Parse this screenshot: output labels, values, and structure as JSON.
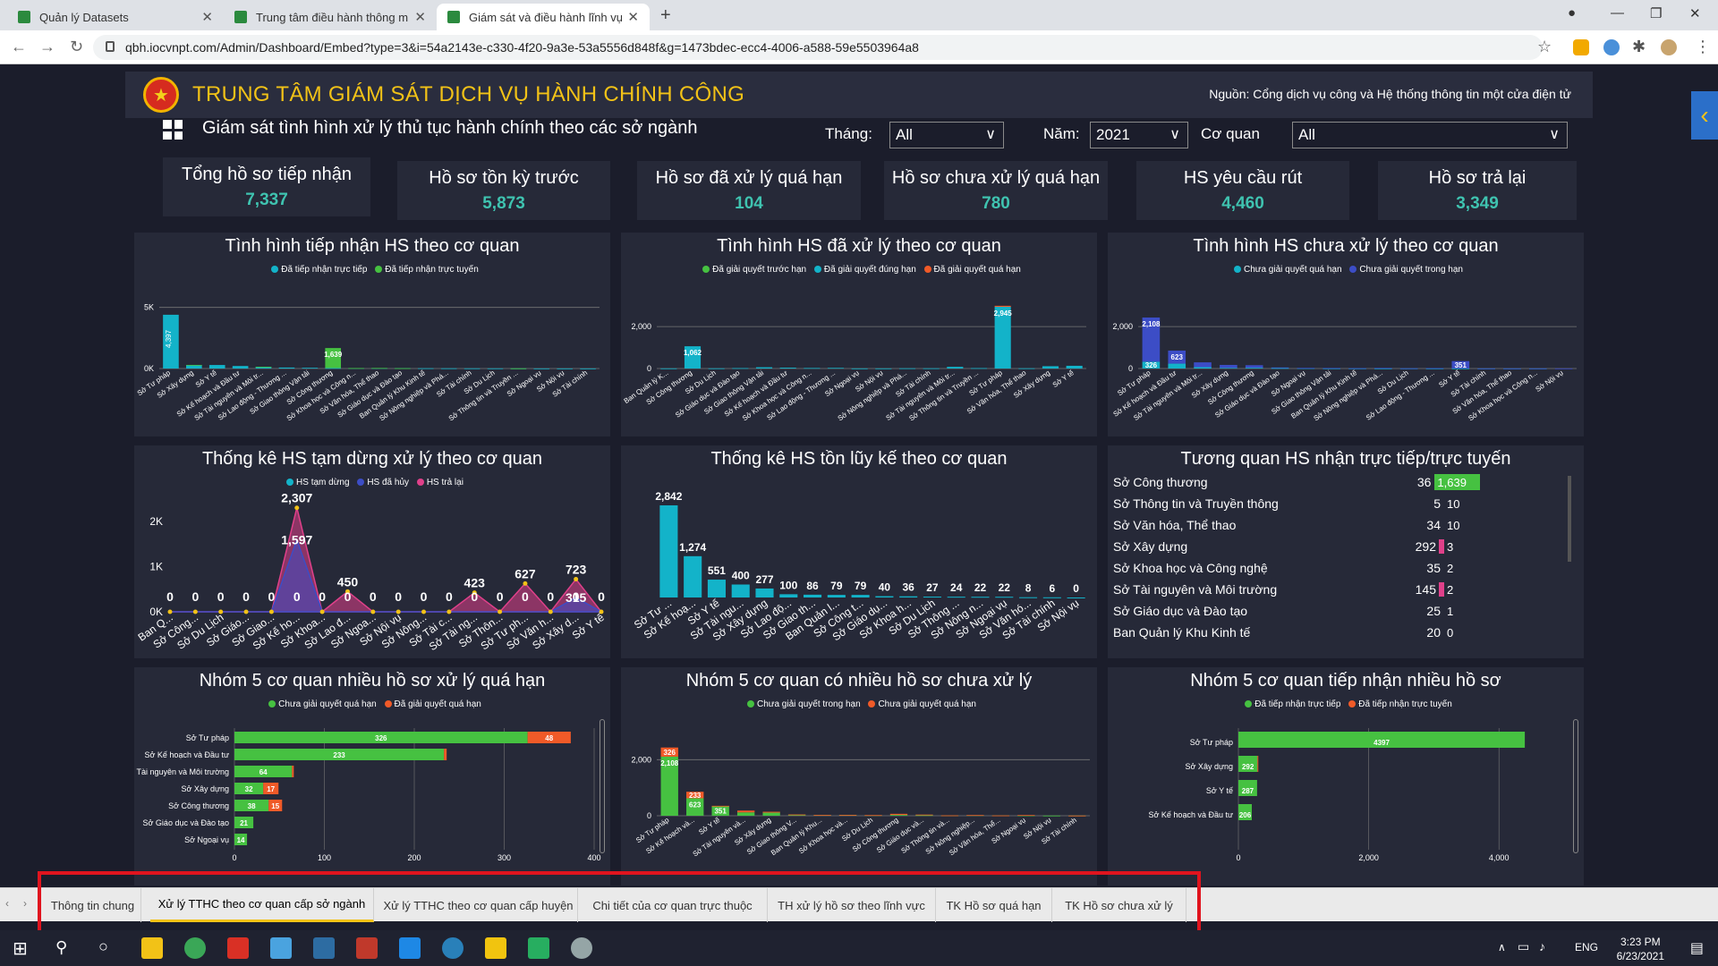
{
  "browser": {
    "tabs": [
      {
        "title": "Quản lý Datasets"
      },
      {
        "title": "Trung tâm điều hành thông minh"
      },
      {
        "title": "Giám sát và điều hành lĩnh vực D"
      }
    ],
    "url": "qbh.iocvnpt.com/Admin/Dashboard/Embed?type=3&i=54a2143e-c330-4f20-9a3e-53a5556d848f&g=1473bdec-ecc4-4006-a588-59e5503964a8"
  },
  "header": {
    "title": "TRUNG TÂM GIÁM SÁT DỊCH VỤ HÀNH CHÍNH CÔNG",
    "source": "Nguồn: Cổng dịch vụ công và Hệ thống thông tin một cửa điện tử"
  },
  "subtitle": "Giám sát tình hình xử lý thủ tục hành chính theo các sở ngành",
  "filters": {
    "month_label": "Tháng:",
    "month_value": "All",
    "year_label": "Năm:",
    "year_value": "2021",
    "agency_label": "Cơ quan",
    "agency_value": "All"
  },
  "kpis": [
    {
      "label": "Tổng hồ sơ tiếp nhận",
      "value": "7,337"
    },
    {
      "label": "Hồ sơ tồn kỳ trước",
      "value": "5,873"
    },
    {
      "label": "Hồ sơ đã xử lý quá hạn",
      "value": "104"
    },
    {
      "label": "Hồ sơ chưa xử lý quá hạn",
      "value": "780"
    },
    {
      "label": "HS yêu cầu rút",
      "value": "4,460"
    },
    {
      "label": "Hồ sơ trả lại",
      "value": "3,349"
    }
  ],
  "panels": {
    "p1": {
      "title": "Tình hình tiếp nhận HS theo cơ quan",
      "legend": [
        "Đã tiếp nhận trực tiếp",
        "Đã tiếp nhận trực tuyến"
      ]
    },
    "p2": {
      "title": "Tình hình HS đã xử lý theo cơ quan",
      "legend": [
        "Đã giải quyết trước hạn",
        "Đã giải quyết đúng hạn",
        "Đã giải quyết quá hạn"
      ]
    },
    "p3": {
      "title": "Tình hình HS chưa xử lý theo cơ quan",
      "legend": [
        "Chưa giải quyết quá hạn",
        "Chưa giải quyết trong hạn"
      ]
    },
    "p4": {
      "title": "Thống kê HS tạm dừng xử lý theo cơ quan",
      "legend": [
        "HS tạm dừng",
        "HS đã hủy",
        "HS trả lại"
      ]
    },
    "p5": {
      "title": "Thống kê HS tồn lũy kế theo cơ quan"
    },
    "p6": {
      "title": "Tương quan HS nhận trực tiếp/trực tuyến"
    },
    "p7": {
      "title": "Nhóm 5 cơ quan nhiều hồ sơ xử lý quá hạn",
      "legend": [
        "Chưa giải quyết quá hạn",
        "Đã giải quyết quá hạn"
      ]
    },
    "p8": {
      "title": "Nhóm 5 cơ quan có nhiều hồ sơ chưa xử lý",
      "legend": [
        "Chưa giải quyết trong hạn",
        "Chưa giải quyết quá hạn"
      ]
    },
    "p9": {
      "title": "Nhóm 5 cơ quan tiếp nhận nhiều hồ sơ",
      "legend": [
        "Đã tiếp nhận trực tiếp",
        "Đã tiếp nhận trực tuyến"
      ]
    }
  },
  "correlation": [
    {
      "name": "Sở Công thương",
      "direct": "36",
      "online": "1,639"
    },
    {
      "name": "Sở Thông tin và Truyền thông",
      "direct": "5",
      "online": "10"
    },
    {
      "name": "Sở Văn hóa, Thể thao",
      "direct": "34",
      "online": "10"
    },
    {
      "name": "Sở Xây dựng",
      "direct": "292",
      "online": "3"
    },
    {
      "name": "Sở Khoa học và Công nghệ",
      "direct": "35",
      "online": "2"
    },
    {
      "name": "Sở Tài nguyên và Môi trường",
      "direct": "145",
      "online": "2"
    },
    {
      "name": "Sở Giáo dục và Đào tạo",
      "direct": "25",
      "online": "1"
    },
    {
      "name": "Ban Quản lý Khu Kinh tế",
      "direct": "20",
      "online": "0"
    }
  ],
  "report_tabs": [
    {
      "label": "Thông tin chung"
    },
    {
      "label": "Xử lý TTHC theo cơ quan cấp sở ngành"
    },
    {
      "label": "Xử lý TTHC theo cơ quan cấp huyện"
    },
    {
      "label": "Chi tiết của cơ quan trực thuộc"
    },
    {
      "label": "TH xử lý hồ sơ theo lĩnh vực"
    },
    {
      "label": "TK Hồ sơ quá hạn"
    },
    {
      "label": "TK Hồ sơ chưa xử lý"
    }
  ],
  "taskbar": {
    "lang": "ENG",
    "time": "3:23 PM",
    "date": "6/23/2021"
  },
  "colors": {
    "teal": "#13b3c9",
    "green": "#46c141",
    "blue": "#3c4dc6",
    "orange": "#f05a28",
    "pink": "#e0408a",
    "yellow": "#f2c217"
  },
  "chart_data": [
    {
      "type": "bar",
      "title": "Tình hình tiếp nhận HS theo cơ quan",
      "categories": [
        "Sở Tư pháp",
        "Sở Xây dựng",
        "Sở Y tế",
        "Sở Kế hoạch và Đầu tư",
        "Sở Tài nguyên và Môi tr...",
        "Sở Lao động - Thương ...",
        "Sở Giao thông Vận tải",
        "Sở Công thương",
        "Sở Khoa học và Công n...",
        "Sở Văn hóa, Thể thao",
        "Sở Giáo dục và Đào tạo",
        "Ban Quản lý Khu Kinh tế",
        "Sở Nông nghiệp và Phá...",
        "Sở Tài chính",
        "Sở Du Lịch",
        "Sở Thông tin và Truyền ...",
        "Sở Ngoại vụ",
        "Sở Nội vụ",
        "Sở Tài chính"
      ],
      "series": [
        {
          "name": "Đã tiếp nhận trực tiếp",
          "values": [
            4397,
            292,
            287,
            206,
            145,
            80,
            60,
            36,
            35,
            34,
            25,
            20,
            15,
            12,
            10,
            5,
            4,
            3,
            2
          ],
          "labels": {
            "0": "4,397"
          }
        },
        {
          "name": "Đã tiếp nhận trực tuyến",
          "values": [
            0,
            3,
            0,
            0,
            2,
            0,
            0,
            1639,
            2,
            10,
            1,
            0,
            0,
            0,
            0,
            10,
            0,
            0,
            0
          ],
          "labels": {
            "7": "1,639"
          }
        }
      ],
      "ylim": [
        0,
        6000
      ],
      "yticks": [
        "0K",
        "5K"
      ],
      "stacked": true
    },
    {
      "type": "bar",
      "title": "Tình hình HS đã xử lý theo cơ quan",
      "categories": [
        "Ban Quản lý K...",
        "Sở Công thương",
        "Sở Du Lịch",
        "Sở Giáo dục và Đào tạo",
        "Sở Giao thông Vận tải",
        "Sở Kế hoạch và Đầu tư",
        "Sở Khoa học và Công n...",
        "Sở Lao động - Thương ...",
        "Sở Ngoại vụ",
        "Sở Nội vụ",
        "Sở Nông nghiệp và Phá...",
        "Sở Tài chính",
        "Sở Tài nguyên và Môi tr...",
        "Sở Thông tin và Truyền ...",
        "Sở Tư pháp",
        "Sở Văn hóa, Thể thao",
        "Sở Xây dựng",
        "Sở Y tế"
      ],
      "series": [
        {
          "name": "Đã giải quyết trước hạn",
          "values": [
            0,
            0,
            0,
            0,
            0,
            0,
            0,
            0,
            0,
            0,
            0,
            0,
            0,
            0,
            0,
            0,
            0,
            0
          ]
        },
        {
          "name": "Đã giải quyết đúng hạn",
          "values": [
            5,
            1062,
            8,
            20,
            60,
            40,
            25,
            30,
            3,
            4,
            10,
            10,
            80,
            20,
            2945,
            10,
            110,
            130
          ],
          "labels": {
            "1": "1,062",
            "14": "2,945"
          }
        },
        {
          "name": "Đã giải quyết quá hạn",
          "values": [
            0,
            0,
            0,
            0,
            0,
            0,
            0,
            0,
            0,
            0,
            0,
            0,
            0,
            0,
            48,
            0,
            0,
            0
          ]
        }
      ],
      "ylim": [
        0,
        3500
      ],
      "yticks": [
        "0",
        "2,000"
      ],
      "stacked": true
    },
    {
      "type": "bar",
      "title": "Tình hình HS chưa xử lý theo cơ quan",
      "categories": [
        "Sở Tư pháp",
        "Sở Kế hoạch và Đầu tư",
        "Sở Tài nguyên và Môi tr...",
        "Sở Xây dựng",
        "Sở Công thương",
        "Sở Giáo dục và Đào tạo",
        "Sở Ngoại vụ",
        "Sở Giao thông Vận tải",
        "Ban Quản lý Khu Kinh tế",
        "Sở Nông nghiệp và Phá...",
        "Sở Du Lịch",
        "Sở Lao động - Thương ...",
        "Sở Y tế",
        "Sở Tài chính",
        "Sở Văn hóa, Thể thao",
        "Sở Khoa học và Công n...",
        "Sở Nội vụ"
      ],
      "series": [
        {
          "name": "Chưa giải quyết quá hạn",
          "values": [
            326,
            233,
            64,
            32,
            38,
            21,
            14,
            5,
            3,
            3,
            2,
            2,
            3,
            1,
            1,
            1,
            0
          ],
          "labels": {
            "0": "326"
          }
        },
        {
          "name": "Chưa giải quyết trong hạn",
          "values": [
            2108,
            623,
            230,
            140,
            120,
            30,
            15,
            20,
            15,
            25,
            10,
            20,
            351,
            5,
            5,
            5,
            3
          ],
          "labels": {
            "0": "2,108",
            "1": "623",
            "12": "351"
          }
        }
      ],
      "ylim": [
        0,
        3500
      ],
      "yticks": [
        "0",
        "2,000"
      ],
      "stacked": true
    },
    {
      "type": "area",
      "title": "Thống kê HS tạm dừng xử lý theo cơ quan",
      "categories": [
        "Ban Q...",
        "Sở Công...",
        "Sở Du Lịch",
        "Sở Giáo...",
        "Sở Giao...",
        "Sở Kế ho...",
        "Sở Khoa...",
        "Sở Lao đ...",
        "Sở Ngoa...",
        "Sở Nội vụ",
        "Sở Nông...",
        "Sở Tài c...",
        "Sở Tài ng...",
        "Sở Thôn...",
        "Sở Tư ph...",
        "Sở Văn h...",
        "Sở Xây d...",
        "Sở Y tế"
      ],
      "series": [
        {
          "name": "HS tạm dừng",
          "values": [
            0,
            0,
            0,
            0,
            0,
            0,
            0,
            0,
            0,
            0,
            0,
            0,
            0,
            0,
            0,
            0,
            0,
            0
          ]
        },
        {
          "name": "HS đã hủy",
          "values": [
            0,
            0,
            0,
            0,
            0,
            1597,
            0,
            0,
            0,
            0,
            0,
            0,
            0,
            0,
            0,
            0,
            315,
            0
          ]
        },
        {
          "name": "HS trả lại",
          "values": [
            0,
            0,
            0,
            0,
            0,
            2307,
            0,
            450,
            0,
            0,
            0,
            0,
            423,
            0,
            627,
            0,
            723,
            0
          ]
        }
      ],
      "point_labels": [
        "0",
        "0",
        "0",
        "0",
        "0",
        "2,307",
        "0",
        "450",
        "0",
        "0",
        "0",
        "0",
        "423",
        "0",
        "627",
        "0",
        "723",
        "0"
      ],
      "point_labels_2": {
        "5": "1,597",
        "16": "315"
      },
      "zero_labels": [
        "0",
        "0",
        "0",
        "0",
        "0",
        "0",
        "0",
        "0",
        "0",
        "0",
        "0",
        "0",
        "0",
        "0",
        "0",
        "0",
        "0",
        "0"
      ],
      "ylim": [
        0,
        2500
      ],
      "yticks": [
        "0K",
        "1K",
        "2K"
      ]
    },
    {
      "type": "bar",
      "title": "Thống kê HS tồn lũy kế theo cơ quan",
      "categories": [
        "Sở Tư ...",
        "Sở Kế hoạ...",
        "Sở Y tế",
        "Sở Tài ngu...",
        "Sở Xây dựng",
        "Sở Lao độ...",
        "Sở Giao th...",
        "Ban Quản l...",
        "Sở Công t...",
        "Sở Giáo dụ...",
        "Sở Khoa h...",
        "Sở Du Lịch",
        "Sở Thông ...",
        "Sở Nông n...",
        "Sở Ngoại vụ",
        "Sở Văn hó...",
        "Sở Tài chính",
        "Sở Nội vụ"
      ],
      "values": [
        2842,
        1274,
        551,
        400,
        277,
        100,
        86,
        79,
        79,
        40,
        36,
        27,
        24,
        22,
        22,
        8,
        6,
        0
      ],
      "labels": [
        "2,842",
        "1,274",
        "551",
        "400",
        "277",
        "100",
        "86",
        "79",
        "79",
        "40",
        "36",
        "27",
        "24",
        "22",
        "22",
        "8",
        "6",
        "0"
      ],
      "ylim": [
        0,
        3200
      ]
    },
    {
      "type": "bar",
      "title": "Nhóm 5 cơ quan nhiều hồ sơ xử lý quá hạn",
      "categories": [
        "Sở Tư pháp",
        "Sở Kế hoạch và Đầu tư",
        "Sở Tài nguyên và Môi trường",
        "Sở Xây dựng",
        "Sở Công thương",
        "Sở Giáo dục và Đào tạo",
        "Sở Ngoại vụ"
      ],
      "series": [
        {
          "name": "Chưa giải quyết quá hạn",
          "values": [
            326,
            233,
            64,
            32,
            38,
            21,
            14
          ]
        },
        {
          "name": "Đã giải quyết quá hạn",
          "values": [
            48,
            3,
            2,
            17,
            15,
            0,
            0
          ]
        }
      ],
      "xlim": [
        0,
        400
      ],
      "xticks": [
        "0",
        "100",
        "200",
        "300",
        "400"
      ],
      "orientation": "horizontal",
      "stacked": true
    },
    {
      "type": "bar",
      "title": "Nhóm 5 cơ quan có nhiều hồ sơ chưa xử lý",
      "categories": [
        "Sở Tư pháp",
        "Sở Kế hoạch và...",
        "Sở Y tế",
        "Sở Tài nguyên và...",
        "Sở Xây dựng",
        "Sở Giao thông V...",
        "Ban Quản lý Khu...",
        "Sở Khoa học và...",
        "Sở Du Lịch",
        "Sở Công thương",
        "Sở Giáo dục và...",
        "Sở Thông tin và...",
        "Sở Nông nghiệp...",
        "Sở Văn hóa, Thể...",
        "Sở Ngoại vụ",
        "Sở Nội vụ",
        "Sở Tài chính"
      ],
      "series": [
        {
          "name": "Chưa giải quyết trong hạn",
          "values": [
            2108,
            623,
            351,
            120,
            110,
            40,
            25,
            30,
            20,
            30,
            20,
            10,
            20,
            10,
            10,
            5,
            5
          ],
          "labels": {
            "0": "2,108",
            "1": "623",
            "2": "351"
          }
        },
        {
          "name": "Chưa giải quyết quá hạn",
          "values": [
            326,
            233,
            3,
            64,
            32,
            5,
            3,
            2,
            2,
            38,
            21,
            3,
            3,
            1,
            14,
            0,
            1
          ],
          "labels": {
            "0": "326",
            "1": "233"
          }
        }
      ],
      "ylim": [
        0,
        3000
      ],
      "yticks": [
        "0",
        "2,000"
      ],
      "stacked": true
    },
    {
      "type": "bar",
      "title": "Nhóm 5 cơ quan tiếp nhận nhiều hồ sơ",
      "categories": [
        "Sở Tư pháp",
        "Sở Xây dựng",
        "Sở Y tế",
        "Sở Kế hoạch và Đầu tư"
      ],
      "series": [
        {
          "name": "Đã tiếp nhận trực tiếp",
          "values": [
            4397,
            292,
            287,
            206
          ]
        },
        {
          "name": "Đã tiếp nhận trực tuyến",
          "values": [
            0,
            3,
            0,
            0
          ]
        }
      ],
      "xlim": [
        0,
        5000
      ],
      "xticks": [
        "0",
        "2,000",
        "4,000"
      ],
      "orientation": "horizontal",
      "stacked": true
    }
  ]
}
